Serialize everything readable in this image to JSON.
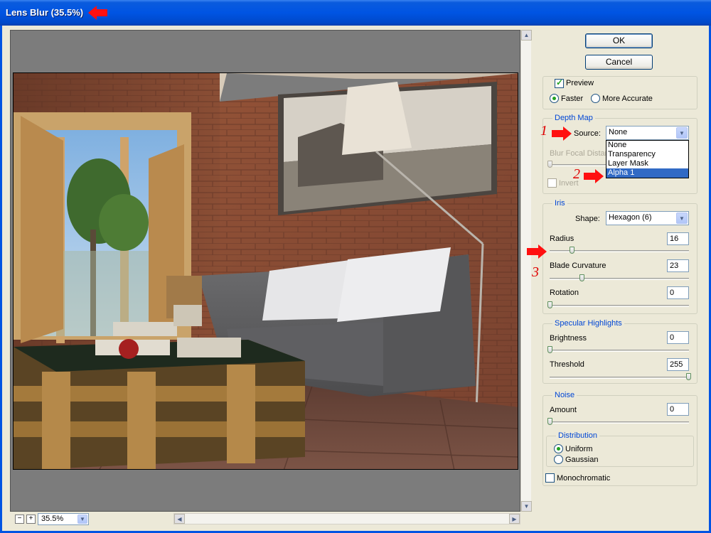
{
  "window": {
    "title": "Lens Blur (35.5%)"
  },
  "buttons": {
    "ok": "OK",
    "cancel": "Cancel"
  },
  "preview": {
    "checkbox_label": "Preview",
    "faster": "Faster",
    "more_accurate": "More Accurate"
  },
  "depth_map": {
    "legend": "Depth Map",
    "source_label": "Source:",
    "source_value": "None",
    "source_options": [
      "None",
      "Transparency",
      "Layer Mask",
      "Alpha 1"
    ],
    "highlighted_option": "Alpha 1",
    "blur_focal_label": "Blur Focal Distance",
    "invert_label": "Invert"
  },
  "iris": {
    "legend": "Iris",
    "shape_label": "Shape:",
    "shape_value": "Hexagon (6)",
    "radius_label": "Radius",
    "radius_value": "16",
    "blade_label": "Blade Curvature",
    "blade_value": "23",
    "rotation_label": "Rotation",
    "rotation_value": "0"
  },
  "specular": {
    "legend": "Specular Highlights",
    "brightness_label": "Brightness",
    "brightness_value": "0",
    "threshold_label": "Threshold",
    "threshold_value": "255"
  },
  "noise": {
    "legend": "Noise",
    "amount_label": "Amount",
    "amount_value": "0",
    "distribution_legend": "Distribution",
    "uniform": "Uniform",
    "gaussian": "Gaussian",
    "monochromatic": "Monochromatic"
  },
  "zoom": {
    "value": "35.5%",
    "minus": "−",
    "plus": "+"
  },
  "annotations": {
    "one": "1",
    "two": "2",
    "three": "3"
  },
  "colors": {
    "titlebar": "#0054E3",
    "dialog_bg": "#ECE9D8",
    "legend_text": "#0046D5",
    "annotation_red": "#E00000",
    "list_highlight": "#316AC5"
  },
  "icons": {
    "arrow_down": "chevron-down-icon",
    "arrow_up": "chevron-up-icon",
    "arrow_left": "chevron-left-icon",
    "arrow_right": "chevron-right-icon"
  },
  "slider_levels": {
    "radius": 0.16,
    "blade_curvature": 0.23,
    "rotation": 0,
    "brightness": 0,
    "threshold": 1.0,
    "amount": 0
  }
}
